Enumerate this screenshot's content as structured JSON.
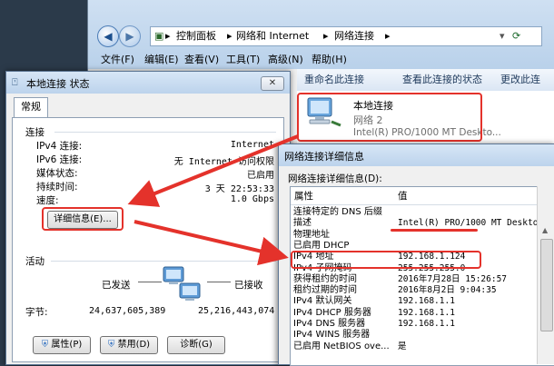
{
  "explorer": {
    "breadcrumb": [
      "控制面板",
      "网络和 Internet",
      "网络连接"
    ],
    "menu": [
      "文件(F)",
      "编辑(E)",
      "查看(V)",
      "工具(T)",
      "高级(N)",
      "帮助(H)"
    ],
    "commands": [
      "重命名此连接",
      "查看此连接的状态",
      "更改此连"
    ],
    "adapter": {
      "name": "本地连接",
      "network": "网络 2",
      "device": "Intel(R) PRO/1000 MT Deskto..."
    }
  },
  "status_dialog": {
    "title": "本地连接 状态",
    "tab": "常规",
    "connection_section": "连接",
    "fields": [
      {
        "label": "IPv4 连接:",
        "value": "Internet"
      },
      {
        "label": "IPv6 连接:",
        "value": "无 Internet 访问权限"
      },
      {
        "label": "媒体状态:",
        "value": "已启用"
      },
      {
        "label": "持续时间:",
        "value": "3 天 22:53:33"
      },
      {
        "label": "速度:",
        "value": "1.0 Gbps"
      }
    ],
    "details_button": "详细信息(E)...",
    "activity_section": "活动",
    "sent_label": "已发送",
    "received_label": "已接收",
    "bytes_label": "字节:",
    "bytes_sent": "24,637,605,389",
    "bytes_received": "25,216,443,074",
    "buttons": [
      "属性(P)",
      "禁用(D)",
      "诊断(G)"
    ]
  },
  "details_dialog": {
    "title": "网络连接详细信息",
    "subtitle": "网络连接详细信息(D):",
    "col_property": "属性",
    "col_value": "值",
    "rows": [
      {
        "p": "连接特定的 DNS 后缀",
        "v": ""
      },
      {
        "p": "描述",
        "v": "Intel(R) PRO/1000 MT Desktop A"
      },
      {
        "p": "物理地址",
        "v": ""
      },
      {
        "p": "已启用 DHCP",
        "v": ""
      },
      {
        "p": "IPv4 地址",
        "v": "192.168.1.124"
      },
      {
        "p": "IPv4 子网掩码",
        "v": "255.255.255.0"
      },
      {
        "p": "获得租约的时间",
        "v": "2016年7月28日 15:26:57"
      },
      {
        "p": "租约过期的时间",
        "v": "2016年8月2日 9:04:35"
      },
      {
        "p": "IPv4 默认网关",
        "v": "192.168.1.1"
      },
      {
        "p": "IPv4 DHCP 服务器",
        "v": "192.168.1.1"
      },
      {
        "p": "IPv4 DNS 服务器",
        "v": "192.168.1.1"
      },
      {
        "p": "IPv4 WINS 服务器",
        "v": ""
      },
      {
        "p": "已启用 NetBIOS ove...",
        "v": "是"
      }
    ]
  },
  "colors": {
    "annotation_red": "#e4322b",
    "title_blue": "#bcd3ec"
  }
}
